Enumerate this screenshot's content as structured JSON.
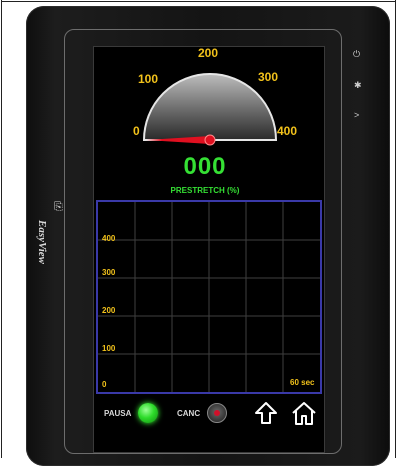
{
  "gauge": {
    "scale_labels": [
      "0",
      "100",
      "200",
      "300",
      "400"
    ],
    "needle_value": 0,
    "accent": "#f2c21b",
    "needle_color": "#e01020"
  },
  "display": {
    "value": "000",
    "caption": "PRESTRETCH (%)",
    "color": "#35e034"
  },
  "chart_data": {
    "type": "line",
    "y_ticks": [
      "400",
      "300",
      "200",
      "100",
      "0"
    ],
    "ylim": [
      0,
      400
    ],
    "x_note": "60 sec",
    "grid": true,
    "series": []
  },
  "controls": {
    "pausa_label": "PAUSA",
    "canc_label": "CANC"
  },
  "brand": {
    "name": "EasyView"
  },
  "icons": {
    "power": "power-icon",
    "light": "light-icon",
    "signal": "signal-icon",
    "up": "up-arrow-icon",
    "home": "home-icon"
  }
}
